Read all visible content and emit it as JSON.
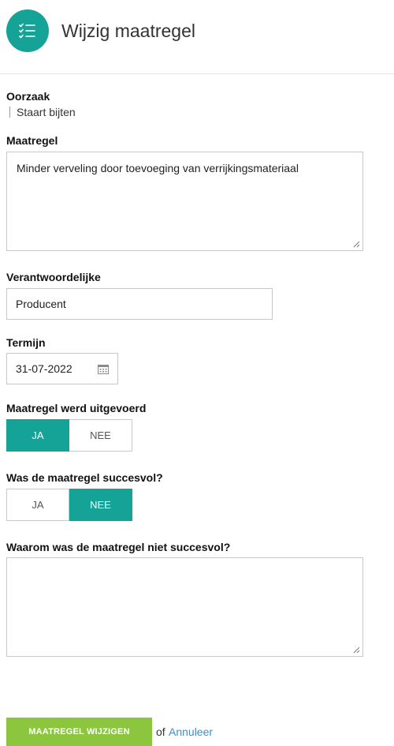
{
  "header": {
    "title": "Wijzig maatregel",
    "icon": "checklist-icon",
    "accent": "#14a396"
  },
  "cause": {
    "label": "Oorzaak",
    "value": "Staart bijten"
  },
  "measure": {
    "label": "Maatregel",
    "value": "Minder verveling door toevoeging van verrijkingsmateriaal"
  },
  "responsible": {
    "label": "Verantwoordelijke",
    "value": "Producent"
  },
  "deadline": {
    "label": "Termijn",
    "value": "31-07-2022",
    "icon": "calendar-icon"
  },
  "executed": {
    "label": "Maatregel werd uitgevoerd",
    "yes": "JA",
    "no": "NEE",
    "selected": "JA"
  },
  "successful": {
    "label": "Was de maatregel succesvol?",
    "yes": "JA",
    "no": "NEE",
    "selected": "NEE"
  },
  "why_not": {
    "label": "Waarom was de maatregel niet succesvol?",
    "value": ""
  },
  "actions": {
    "submit": "MAATREGEL WIJZIGEN",
    "or": "of",
    "cancel": "Annuleer",
    "submit_color": "#8bc63e",
    "link_color": "#3b8fd1"
  }
}
